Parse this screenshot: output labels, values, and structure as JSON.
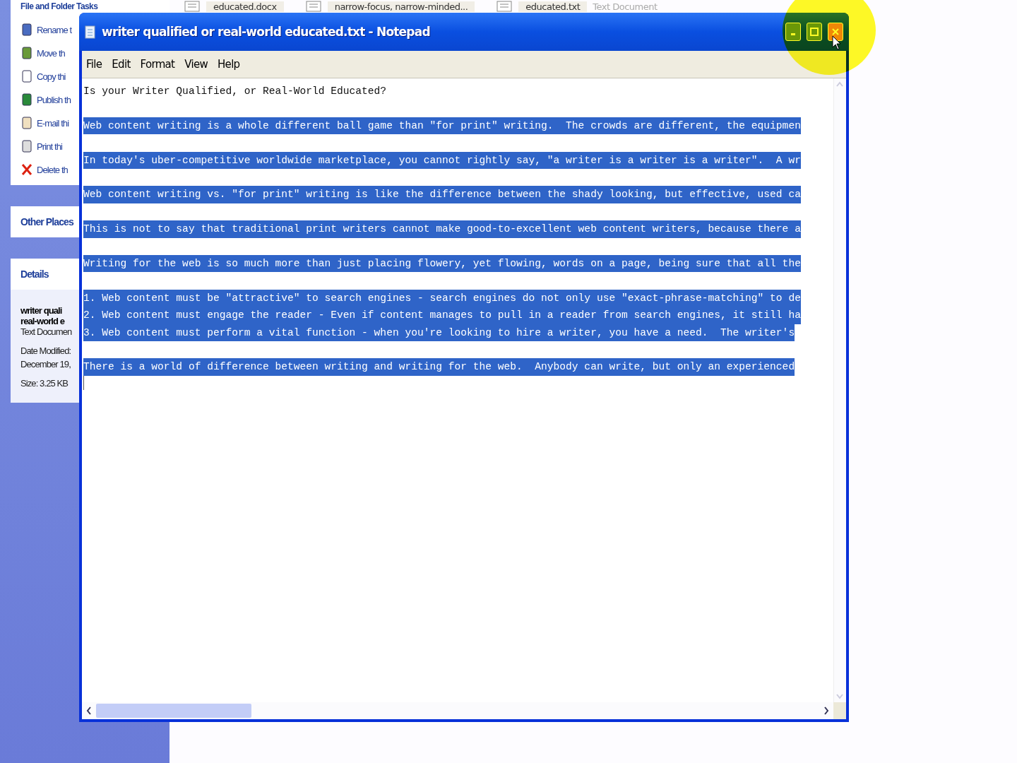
{
  "explorer": {
    "tasks_header": "File and Folder Tasks",
    "tasks": [
      "Rename t",
      "Move th",
      "Copy thi",
      "Publish th",
      "E-mail thi",
      "Print thi",
      "Delete th"
    ],
    "other_places": "Other Places",
    "details_header": "Details",
    "details": {
      "name_lines": [
        "writer quali",
        "real-world e"
      ],
      "type": "Text Documen",
      "date_label": "Date Modified:",
      "date": "December 19,",
      "size": "Size: 3.25 KB"
    },
    "files": [
      {
        "name": "educated.docx"
      },
      {
        "name": "narrow-focus, narrow-minded..."
      },
      {
        "name": "educated.txt",
        "caption": "Text Document"
      }
    ]
  },
  "notepad": {
    "title": "writer qualified or real-world educated.txt - Notepad",
    "menu": [
      "File",
      "Edit",
      "Format",
      "View",
      "Help"
    ],
    "close_hovered": true,
    "lines": [
      {
        "kind": "text",
        "text": "Is your Writer Qualified, or Real-World Educated?",
        "selected": false
      },
      {
        "kind": "blank"
      },
      {
        "kind": "text",
        "text": "Web content writing is a whole different ball game than \"for print\" writing.  The crowds are different, the equipmen",
        "selected": true
      },
      {
        "kind": "blank"
      },
      {
        "kind": "text",
        "text": "In today's uber-competitive worldwide marketplace, you cannot rightly say, \"a writer is a writer is a writer\".  A wr",
        "selected": true
      },
      {
        "kind": "blank"
      },
      {
        "kind": "text",
        "text": "Web content writing vs. \"for print\" writing is like the difference between the shady looking, but effective, used ca",
        "selected": true
      },
      {
        "kind": "blank"
      },
      {
        "kind": "text",
        "text": "This is not to say that traditional print writers cannot make good-to-excellent web content writers, because there a",
        "selected": true
      },
      {
        "kind": "blank"
      },
      {
        "kind": "text",
        "text": "Writing for the web is so much more than just placing flowery, yet flowing, words on a page, being sure that all the",
        "selected": true
      },
      {
        "kind": "blank"
      },
      {
        "kind": "text",
        "text": "1. Web content must be \"attractive\" to search engines - search engines do not only use \"exact-phrase-matching\" to de",
        "selected": true
      },
      {
        "kind": "text",
        "text": "2. Web content must engage the reader - Even if content manages to pull in a reader from search engines, it still ha",
        "selected": true
      },
      {
        "kind": "text",
        "text": "3. Web content must perform a vital function - when you're looking to hire a writer, you have a need.  The writer's",
        "selected": true
      },
      {
        "kind": "blank"
      },
      {
        "kind": "text",
        "text": "There is a world of difference between writing and writing for the web.  Anybody can write, but only an experienced",
        "selected": true
      }
    ]
  }
}
